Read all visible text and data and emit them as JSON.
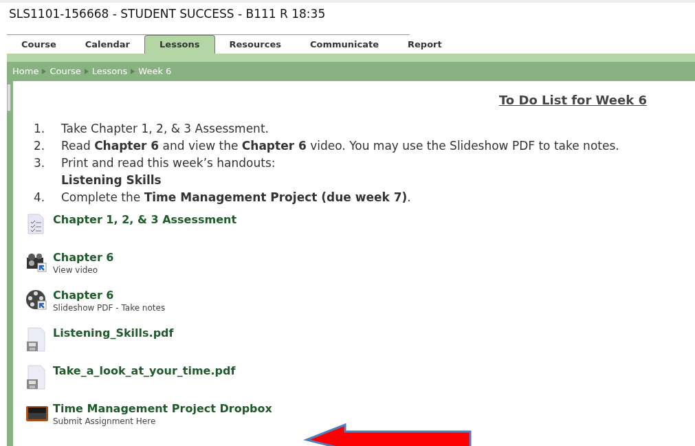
{
  "page_title": "SLS1101-156668 - STUDENT SUCCESS - B111 R 18:35",
  "tabs": [
    {
      "label": "Course",
      "selected": false
    },
    {
      "label": "Calendar",
      "selected": false
    },
    {
      "label": "Lessons",
      "selected": true
    },
    {
      "label": "Resources",
      "selected": false
    },
    {
      "label": "Communicate",
      "selected": false
    },
    {
      "label": "Report",
      "selected": false
    }
  ],
  "breadcrumb": [
    "Home",
    "Course",
    "Lessons",
    "Week 6"
  ],
  "heading": "To Do List for Week 6",
  "todo": [
    {
      "number": "1.",
      "text": "Take Chapter 1, 2, & 3 Assessment."
    },
    {
      "number": "2.",
      "text": "Read **Chapter 6** and view the **Chapter 6** video. You may use the Slideshow PDF to take notes."
    },
    {
      "number": "3.",
      "text": "Print and read this week’s handouts:",
      "handout": "Listening Skills"
    },
    {
      "number": "4.",
      "text": "Complete the **Time Management Project (due week 7)**."
    }
  ],
  "items": [
    {
      "kind": "assessment",
      "title": "Chapter 1, 2, & 3 Assessment"
    },
    {
      "kind": "video",
      "title": "Chapter 6",
      "subtitle": "View video"
    },
    {
      "kind": "film",
      "title": "Chapter 6",
      "subtitle": "Slideshow PDF - Take notes"
    },
    {
      "kind": "file",
      "title": "Listening_Skills.pdf"
    },
    {
      "kind": "file",
      "title": "Take_a_look_at_your_time.pdf"
    },
    {
      "kind": "dropbox",
      "title": "Time Management Project Dropbox",
      "subtitle": "Submit Assignment Here"
    }
  ]
}
